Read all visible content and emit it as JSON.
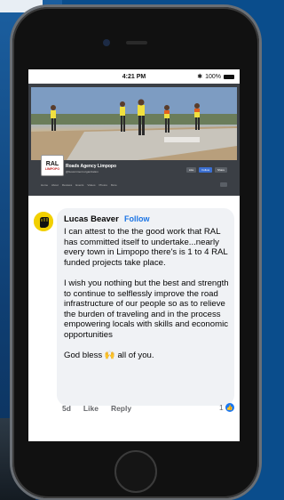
{
  "status_bar": {
    "time": "4:21 PM",
    "battery": "100%"
  },
  "facebook_page": {
    "logo_text": "RAL",
    "logo_sub": "LIMPOPO",
    "name": "Roads Agency Limpopo",
    "subtitle": "@Government organization",
    "actions": [
      "Like",
      "Follow",
      "Share"
    ],
    "tabs": [
      "Home",
      "About",
      "Reviews",
      "Events",
      "Videos",
      "Photos",
      "More"
    ]
  },
  "comment": {
    "author": "Lucas Beaver",
    "follow_label": "Follow",
    "text": "I can attest to the the good work that RAL has committed itself to undertake...nearly every town in Limpopo there's is 1 to 4 RAL funded projects take place.\n\nI wish you nothing but the best and strength to continue to selflessly improve the road infrastructure of our people so as to relieve the burden of traveling and in the process empowering locals with skills and economic opportunities\n\nGod bless 🙌 all of you.",
    "time": "5d",
    "like_label": "Like",
    "reply_label": "Reply",
    "reaction_count": "1"
  },
  "colors": {
    "accent": "#1b74e4",
    "bubble": "#f0f2f5",
    "background": "#0a4d8c"
  }
}
